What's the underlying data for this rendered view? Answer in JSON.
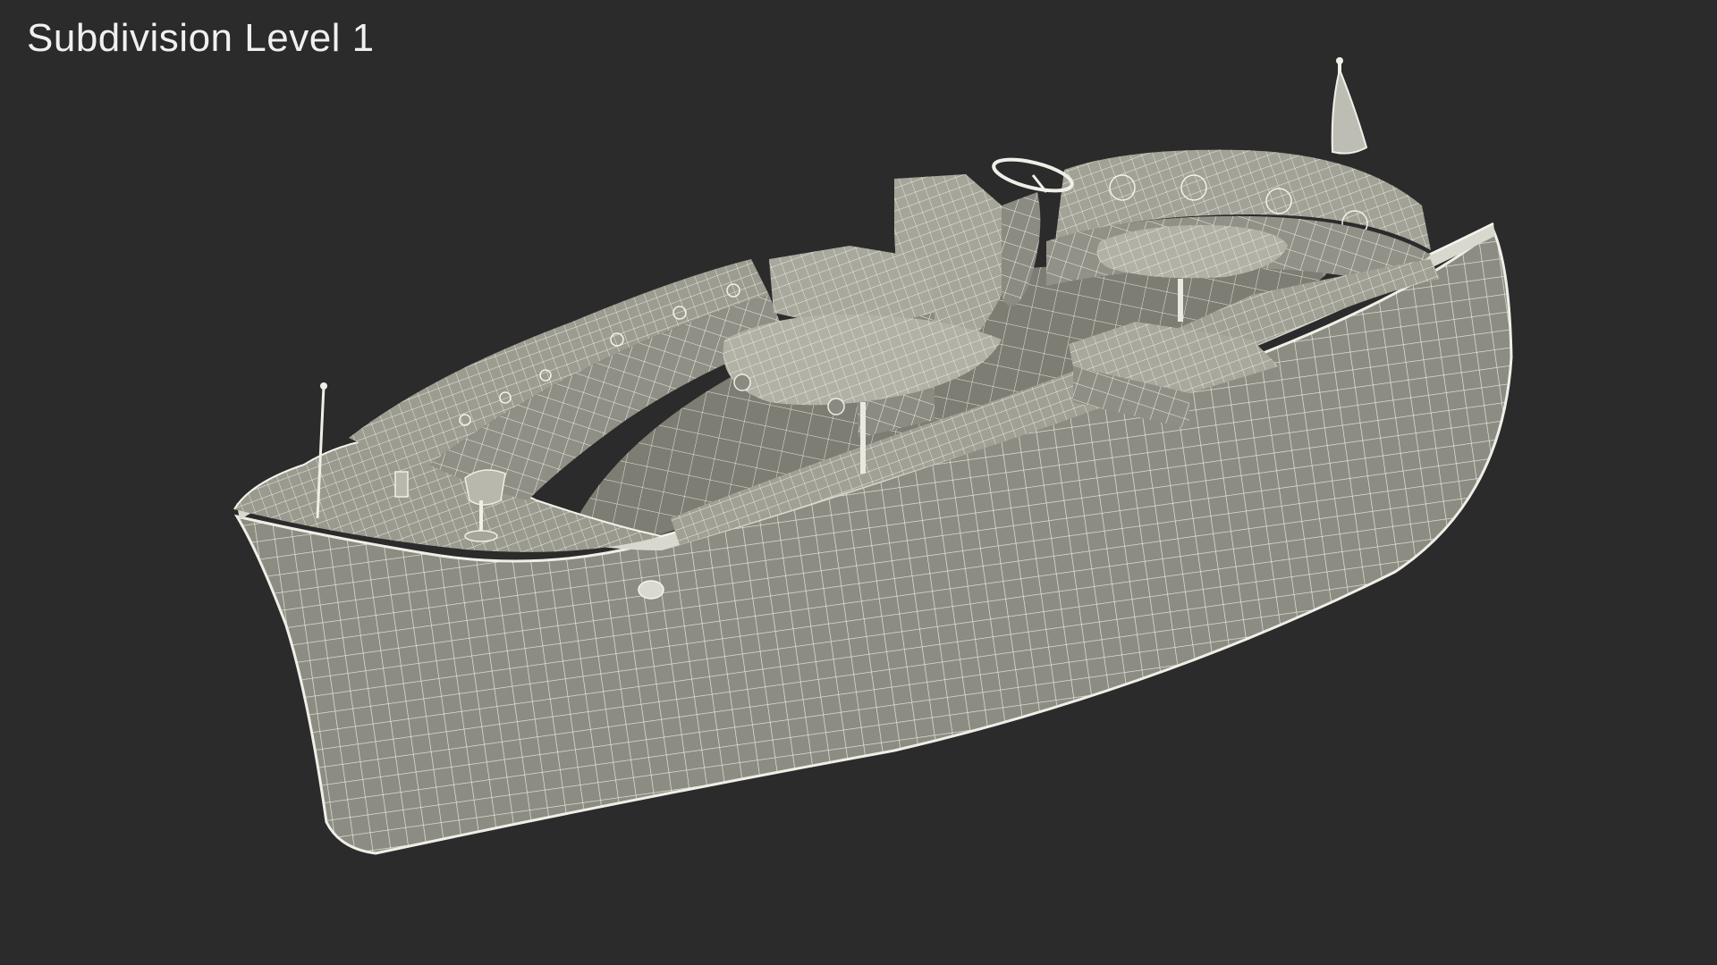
{
  "overlay": {
    "label": "Subdivision Level 1"
  },
  "model": {
    "subject": "boat",
    "render_style": "wireframe",
    "wire_color": "#e9e9e2",
    "surface_color": "#8a8a80",
    "background_color": "#2b2b2b"
  }
}
